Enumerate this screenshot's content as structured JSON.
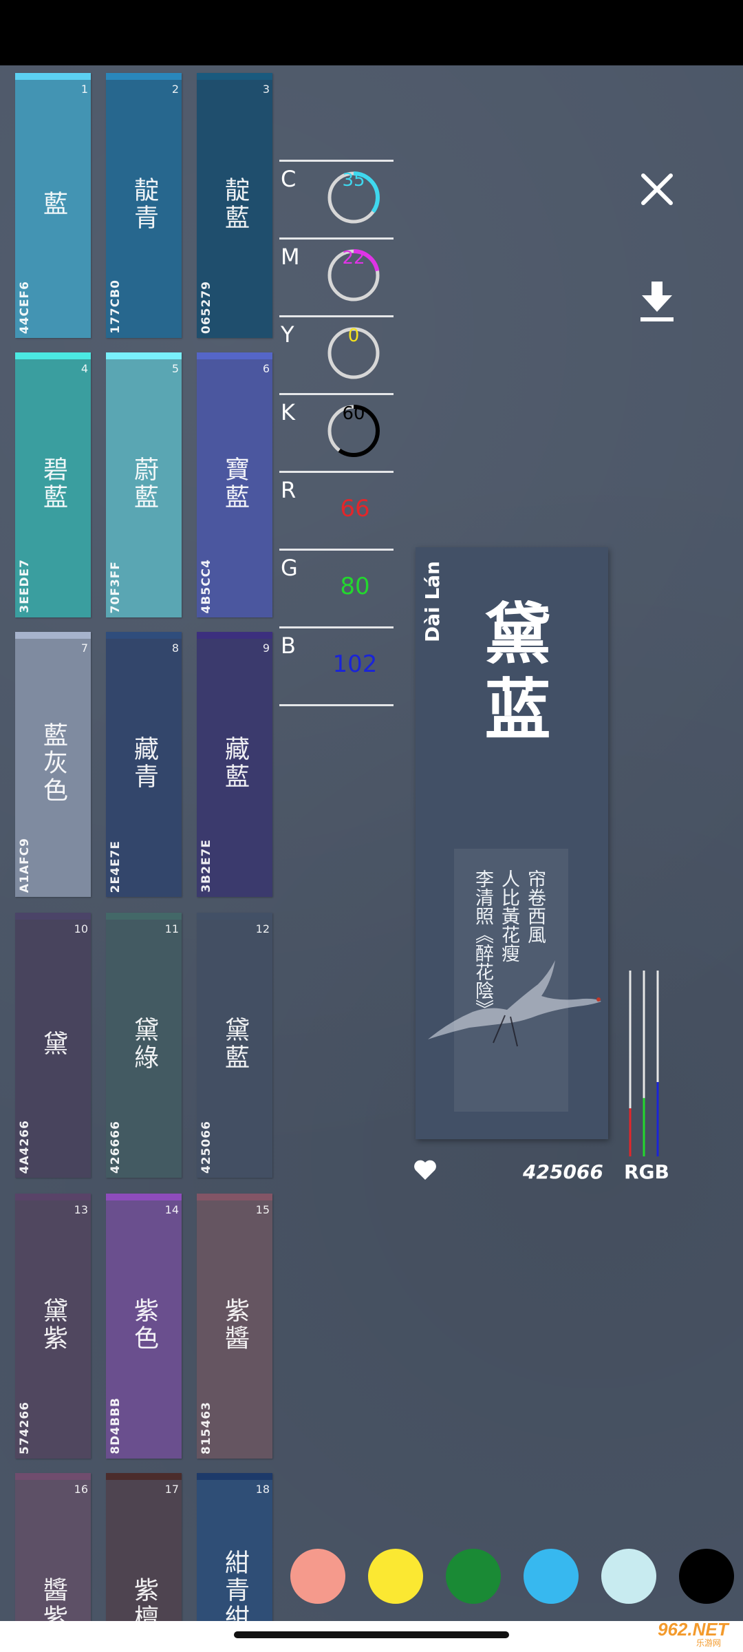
{
  "swatches": [
    {
      "num": "1",
      "name": "藍",
      "hex": "44CEF6",
      "color": "#4394b3",
      "top_color": "#5cd0f2"
    },
    {
      "num": "2",
      "name": "靛青",
      "hex": "177CB0",
      "color": "#27678e",
      "top_color": "#2a87bb"
    },
    {
      "num": "3",
      "name": "靛藍",
      "hex": "065279",
      "color": "#1f4e6d",
      "top_color": "#1a5a7e"
    },
    {
      "num": "4",
      "name": "碧藍",
      "hex": "3EEDE7",
      "color": "#3a9e9f",
      "top_color": "#4be9e2"
    },
    {
      "num": "5",
      "name": "蔚藍",
      "hex": "70F3FF",
      "color": "#5aa6b3",
      "top_color": "#79f0fb"
    },
    {
      "num": "6",
      "name": "寶藍",
      "hex": "4B5CC4",
      "color": "#4b579f",
      "top_color": "#5566c8"
    },
    {
      "num": "7",
      "name": "藍灰色",
      "hex": "A1AFC9",
      "color": "#7f8ba0",
      "top_color": "#a6b3cc"
    },
    {
      "num": "8",
      "name": "藏青",
      "hex": "2E4E7E",
      "color": "#33466b",
      "top_color": "#2f4d7c"
    },
    {
      "num": "9",
      "name": "藏藍",
      "hex": "3B2E7E",
      "color": "#3b3a6d",
      "top_color": "#3c2f7e"
    },
    {
      "num": "10",
      "name": "黛",
      "hex": "4A4266",
      "color": "#48445d",
      "top_color": "#4b4468"
    },
    {
      "num": "11",
      "name": "黛綠",
      "hex": "426666",
      "color": "#435a62",
      "top_color": "#436868"
    },
    {
      "num": "12",
      "name": "黛藍",
      "hex": "425066",
      "color": "#434f63",
      "top_color": "#425066"
    },
    {
      "num": "13",
      "name": "黛紫",
      "hex": "574266",
      "color": "#50475f",
      "top_color": "#594368"
    },
    {
      "num": "14",
      "name": "紫色",
      "hex": "8D4BBB",
      "color": "#6a4f8e",
      "top_color": "#8e4cbc"
    },
    {
      "num": "15",
      "name": "紫醬",
      "hex": "815463",
      "color": "#655561",
      "top_color": "#835566"
    },
    {
      "num": "16",
      "name": "醬紫",
      "hex": "",
      "color": "#5d5066",
      "top_color": "#704d6e"
    },
    {
      "num": "17",
      "name": "紫檀",
      "hex": "",
      "color": "#4e4450",
      "top_color": "#4b2c2c"
    },
    {
      "num": "18",
      "name": "紺青紺紫",
      "hex": "",
      "color": "#2f4e76",
      "top_color": "#1d3a6a"
    }
  ],
  "cmyk": [
    {
      "label": "C",
      "value": 35,
      "text": "35",
      "color": "#3fd8ee"
    },
    {
      "label": "M",
      "value": 22,
      "text": "22",
      "color": "#e034e6"
    },
    {
      "label": "Y",
      "value": 0,
      "text": "0",
      "color": "#f5e31c"
    },
    {
      "label": "K",
      "value": 60,
      "text": "60",
      "color": "#000000"
    }
  ],
  "rgb": [
    {
      "label": "R",
      "value": 66,
      "text": "66",
      "color": "#e3262a"
    },
    {
      "label": "G",
      "value": 80,
      "text": "80",
      "color": "#23d82e"
    },
    {
      "label": "B",
      "value": 102,
      "text": "102",
      "color": "#1a24d8"
    }
  ],
  "card": {
    "pinyin": "Dài Lán",
    "name": "黛蓝",
    "poem_lines": [
      "帘卷西風",
      "人比黃花瘦",
      "李清照《醉花陰》"
    ],
    "background": "#425066"
  },
  "selected_hex": "425066",
  "rgb_label": "RGB",
  "palette": [
    "#f59a8c",
    "#fbe832",
    "#1a8a35",
    "#37b8ef",
    "#c8ebf0",
    "#000000"
  ],
  "watermark": {
    "main": "962.NET",
    "sub": "乐游网"
  },
  "icons": {
    "close": "close-icon",
    "download": "download-icon",
    "like": "heart-icon"
  }
}
